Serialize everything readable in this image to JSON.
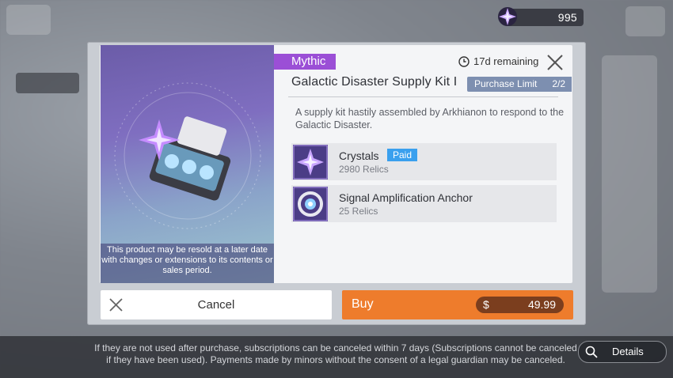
{
  "currency": {
    "amount": "995",
    "icon": "crystal-star-icon"
  },
  "product": {
    "rarity": "Mythic",
    "time_remaining": "17d remaining",
    "title": "Galactic Disaster Supply Kit I",
    "purchase_limit_label": "Purchase Limit",
    "purchase_limit_value": "2/2",
    "description": "A supply kit hastily assembled by Arkhianon to respond to the Galactic Disaster.",
    "resold_note": "This product may be resold at a later date with changes or extensions to its contents or sales period."
  },
  "items": [
    {
      "name": "Crystals",
      "badge": "Paid",
      "amount": "2980 Relics",
      "icon": "crystal-star-icon"
    },
    {
      "name": "Signal Amplification Anchor",
      "badge": "",
      "amount": "25 Relics",
      "icon": "anchor-orb-icon"
    }
  ],
  "actions": {
    "cancel_label": "Cancel",
    "buy_label": "Buy",
    "price_currency": "$",
    "price_amount": "49.99"
  },
  "footer": {
    "note": "If they are not used after purchase, subscriptions can be canceled within 7 days (Subscriptions cannot be canceled if they have been used). Payments made by minors without the consent of a legal guardian may be canceled.",
    "details_label": "Details"
  },
  "colors": {
    "rarity": "#9b4fd6",
    "buy": "#ee7c2c",
    "paid_badge": "#3aa0ee",
    "limit": "#7d8fb0"
  }
}
